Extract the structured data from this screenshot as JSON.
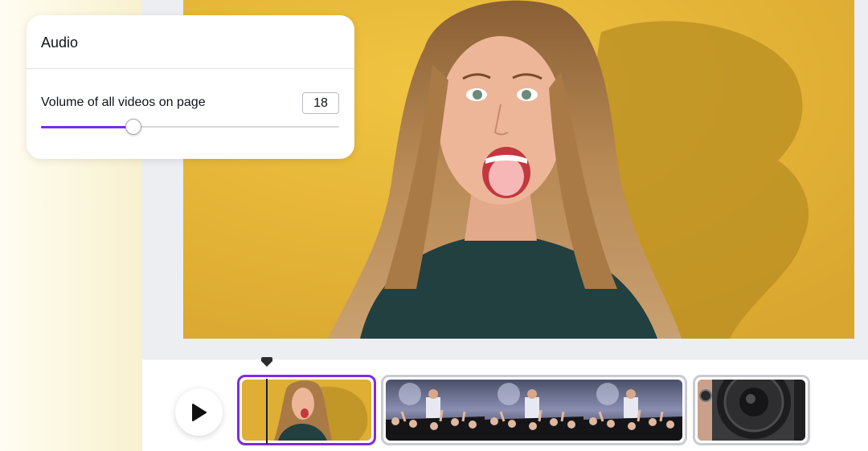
{
  "audio_panel": {
    "title": "Audio",
    "volume_label": "Volume of all videos on page",
    "volume_value": "18",
    "volume_level": 0.31
  },
  "timeline": {
    "clips": [
      {
        "content": "woman shouting against yellow wall",
        "selected": true
      },
      {
        "content": "concert crowd"
      },
      {
        "content": "speaker"
      }
    ]
  },
  "icons": {
    "play": "play-icon",
    "playhead": "playhead-marker-icon"
  },
  "colors": {
    "accent": "#7d2ae8",
    "canvas_background": "#e2b43b"
  }
}
